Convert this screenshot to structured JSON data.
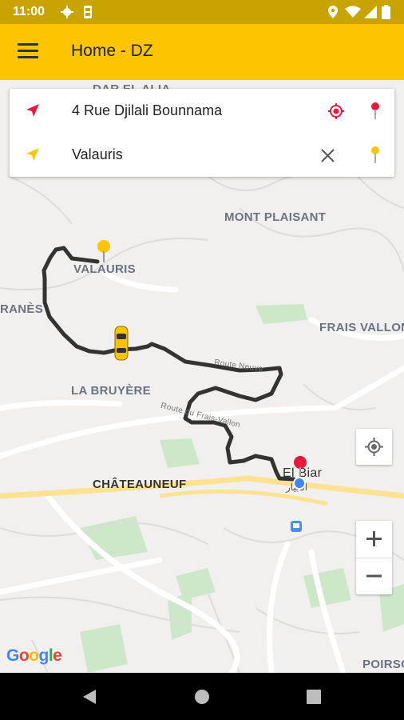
{
  "status_bar": {
    "time": "11:00"
  },
  "app_bar": {
    "title": "Home - DZ"
  },
  "search": {
    "origin": "4 Rue Djilali Bounnama",
    "destination": "Valauris"
  },
  "map_labels": {
    "dar_el_alia": "DAR EL ALIA",
    "mont_plaisant": "MONT PLAISANT",
    "valauris": "VALAURIS",
    "ranes": "RANÈS",
    "frais_vallon": "FRAIS VALLON",
    "la_bruyere": "LA BRUYÈRE",
    "chateauneuf": "CHÂTEAUNEUF",
    "el_biar": "El Biar",
    "el_biar_ar": "الأبيار",
    "poirson": "POIRSO",
    "route_neuve": "Route Neuve",
    "route_frais_vallon": "Route du Frais-Vallon"
  },
  "google_logo": "Google",
  "colors": {
    "accent": "#fcc500",
    "route": "#333333",
    "pin_red": "#e8193c",
    "pin_yellow": "#fcc500",
    "location_blue": "#4285f4"
  }
}
